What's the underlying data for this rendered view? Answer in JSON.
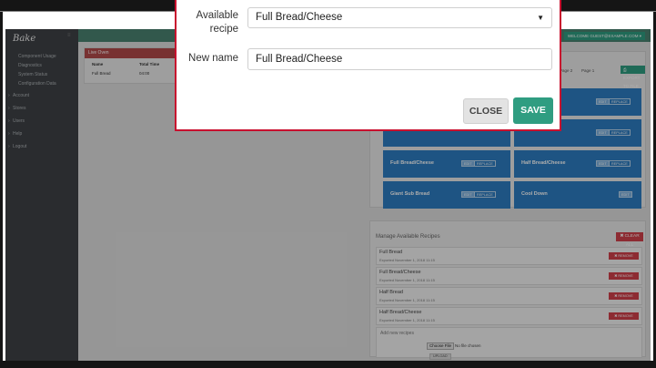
{
  "app": {
    "logo_text": "Bake",
    "welcome": "WELCOME GUEST@EXAMPLE.COM ▾"
  },
  "sidebar": {
    "items": [
      {
        "label": "Component Usage",
        "arrow": ""
      },
      {
        "label": "Diagnostics",
        "arrow": ""
      },
      {
        "label": "System Status",
        "arrow": ""
      },
      {
        "label": "Configuration Data",
        "arrow": ""
      },
      {
        "label": "Account",
        "arrow": "›"
      },
      {
        "label": "Stores",
        "arrow": "›"
      },
      {
        "label": "Users",
        "arrow": "›"
      },
      {
        "label": "Help",
        "arrow": "›"
      },
      {
        "label": "Logout",
        "arrow": "›"
      }
    ]
  },
  "live_oven": {
    "title": "Live Oven",
    "headers": [
      "Name",
      "Total Time"
    ],
    "rows": [
      [
        "Full Bread",
        "04:00"
      ]
    ]
  },
  "recipes_panel": {
    "pager_prev": "Page 2",
    "pager_current": "Page 1",
    "export_label": "⎙ EXPORT TO FILE",
    "edit_label": "EDIT",
    "replace_label": "REPLACE",
    "tiles": [
      {
        "name": ""
      },
      {
        "name": ""
      },
      {
        "name": ""
      },
      {
        "name": ""
      },
      {
        "name": "Full Bread/Cheese"
      },
      {
        "name": "Half Bread/Cheese"
      },
      {
        "name": "Giant Sub Bread"
      },
      {
        "name": "Cool Down"
      }
    ]
  },
  "manage": {
    "title": "Manage Available Recipes",
    "clear_all": "✖ CLEAR ALL",
    "remove_label": "✖ REMOVE",
    "rows": [
      {
        "name": "Full Bread",
        "date": "Exported November 1, 2018 11:15"
      },
      {
        "name": "Full Bread/Cheese",
        "date": "Exported November 1, 2018 11:15"
      },
      {
        "name": "Half Bread",
        "date": "Exported November 1, 2018 11:15"
      },
      {
        "name": "Half Bread/Cheese",
        "date": "Exported November 1, 2018 11:15"
      }
    ],
    "add_title": "Add new recipes",
    "choose_file": "Choose File",
    "no_file": "No file chosen",
    "upload": "UPLOAD"
  },
  "modal": {
    "available_label": "Available recipe",
    "selected_recipe": "Full Bread/Cheese",
    "new_name_label": "New name",
    "new_name_value": "Full Bread/Cheese",
    "close_label": "CLOSE",
    "save_label": "SAVE"
  },
  "colors": {
    "accent_green": "#2f9d81",
    "modal_border_red": "#c8102e",
    "tile_blue": "#2d7cc1",
    "remove_red": "#d0404a"
  }
}
